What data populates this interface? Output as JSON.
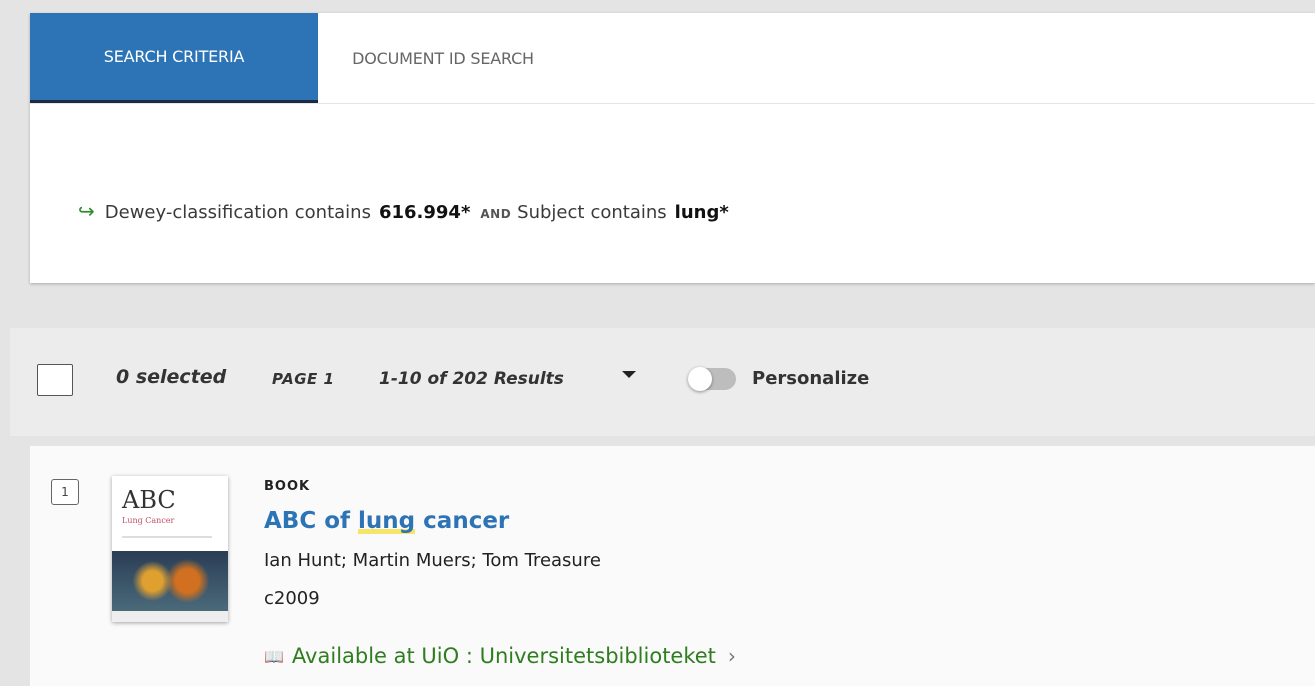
{
  "tabs": [
    {
      "label": "SEARCH CRITERIA"
    },
    {
      "label": "DOCUMENT ID SEARCH"
    }
  ],
  "query": {
    "arrow": "↪",
    "field1": "Dewey-classification",
    "verb1": "contains",
    "value1": "616.994*",
    "operator": "AND",
    "field2": "Subject",
    "verb2": "contains",
    "value2": "lung*"
  },
  "results_bar": {
    "selected": "0 selected",
    "page": "PAGE 1",
    "range": "1-10 of 202 Results",
    "personalize": "Personalize"
  },
  "result": {
    "number": "1",
    "type": "BOOK",
    "title_pre": "ABC of ",
    "title_hl": "lung",
    "title_post": " cancer",
    "authors": "Ian Hunt; Martin Muers; Tom Treasure",
    "date": "c2009",
    "availability": "Available at UiO : Universitetsbiblioteket",
    "cover_title": "ABC",
    "cover_subtitle": "Lung Cancer"
  },
  "colors": {
    "accent": "#2c74b5",
    "available": "#2e7d1e"
  }
}
